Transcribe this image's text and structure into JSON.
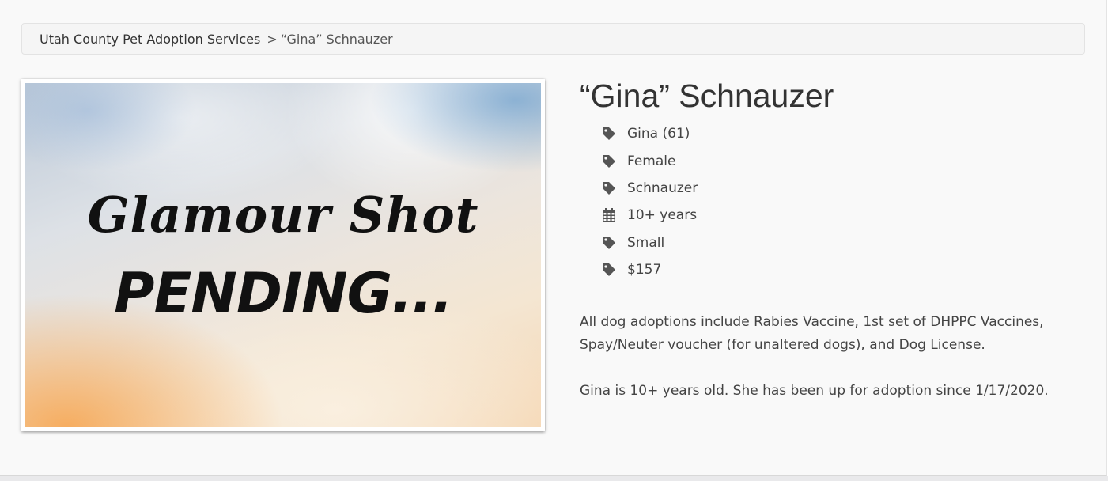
{
  "breadcrumb": {
    "home": "Utah County Pet Adoption Services",
    "separator": ">",
    "current": "“Gina” Schnauzer"
  },
  "photo": {
    "line1": "Glamour Shot",
    "line2": "PENDING..."
  },
  "pet": {
    "title": "“Gina” Schnauzer",
    "facts": [
      {
        "icon": "tag-icon",
        "text": "Gina (61)"
      },
      {
        "icon": "tag-icon",
        "text": "Female"
      },
      {
        "icon": "tag-icon",
        "text": "Schnauzer"
      },
      {
        "icon": "calendar-icon",
        "text": "10+ years"
      },
      {
        "icon": "tag-icon",
        "text": "Small"
      },
      {
        "icon": "tag-icon",
        "text": "$157"
      }
    ],
    "adoption_info": "All dog adoptions include Rabies Vaccine, 1st set of DHPPC Vaccines, Spay/Neuter voucher (for unaltered dogs), and Dog License.",
    "summary": "Gina is 10+ years old. She has been up for adoption since 1/17/2020."
  },
  "colors": {
    "page_background": "#f9f9f9",
    "breadcrumb_background": "#f5f5f5",
    "text": "#444444",
    "icon": "#555555"
  }
}
